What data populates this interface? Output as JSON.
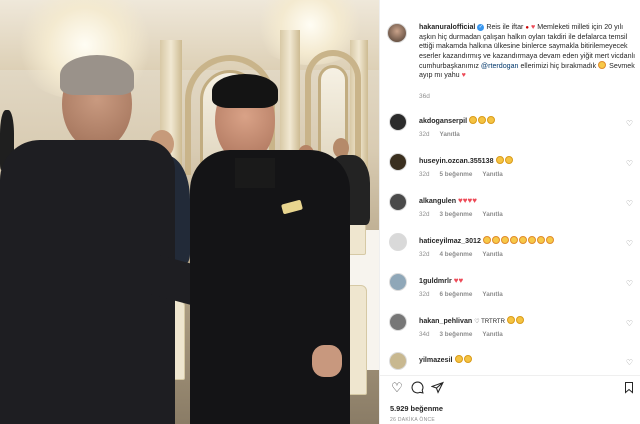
{
  "post": {
    "username": "hakanuralofficial",
    "caption_lead": "Reis ile iftar",
    "caption_body": "Memleketi milleti için 20 yılı aşkın hiç durmadan çalışan halkın oyları takdiri ile defalarca temsil ettiği makamda halkına ülkesine binlerce saymakla bitirilemeyecek eserler kazandırmış ve kazandırmaya devam eden yiğit mert vicdanlı cumhurbaşkanımız",
    "caption_mention": "@rterdogan",
    "caption_tail": "ellerimizi hiç bırakmadık",
    "caption_end": "Sevmek ayıp mı yahu",
    "time": "36d",
    "likes": "5.929 beğenme",
    "posted": "26 DAKİKA ÖNCE"
  },
  "comments": [
    {
      "user": "akdoganserpil",
      "text": "",
      "emojis": [
        "clap",
        "clap",
        "clap"
      ],
      "time": "32d",
      "likes": "",
      "reply": "Yanıtla",
      "avatar_color": "#2b2b2b"
    },
    {
      "user": "huseyin.ozcan.355138",
      "text": "",
      "emojis": [
        "clap",
        "clap"
      ],
      "time": "32d",
      "likes": "5 beğenme",
      "reply": "Yanıtla",
      "avatar_color": "#3a2f1f"
    },
    {
      "user": "alkangulen",
      "text": "",
      "emojis": [
        "heart",
        "heart",
        "heart",
        "heart"
      ],
      "time": "32d",
      "likes": "3 beğenme",
      "reply": "Yanıtla",
      "avatar_color": "#4a4a4a"
    },
    {
      "user": "haticeyilmaz_3012",
      "text": "",
      "emojis": [
        "laugh",
        "laugh",
        "laugh",
        "laugh",
        "laugh",
        "laugh",
        "laugh",
        "laugh"
      ],
      "time": "32d",
      "likes": "4 beğenme",
      "reply": "Yanıtla",
      "avatar_color": "#d9d9d9"
    },
    {
      "user": "1guldmrlr",
      "text": "",
      "emojis": [
        "heart",
        "heart"
      ],
      "time": "32d",
      "likes": "6 beğenme",
      "reply": "Yanıtla",
      "avatar_color": "#8fa7b8"
    },
    {
      "user": "hakan_pehlivan",
      "text": "♡ TRTRTR",
      "emojis": [
        "clap",
        "clap"
      ],
      "time": "34d",
      "likes": "3 beğenme",
      "reply": "Yanıtla",
      "avatar_color": "#777777"
    },
    {
      "user": "yilmazesil",
      "text": "",
      "emojis": [
        "clap",
        "clap"
      ],
      "time": "",
      "likes": "",
      "reply": "",
      "avatar_color": "#c8b890"
    }
  ],
  "icons": {
    "heart": "heart-outline-icon",
    "comment": "comment-icon",
    "share": "paper-plane-icon",
    "save": "bookmark-icon"
  }
}
